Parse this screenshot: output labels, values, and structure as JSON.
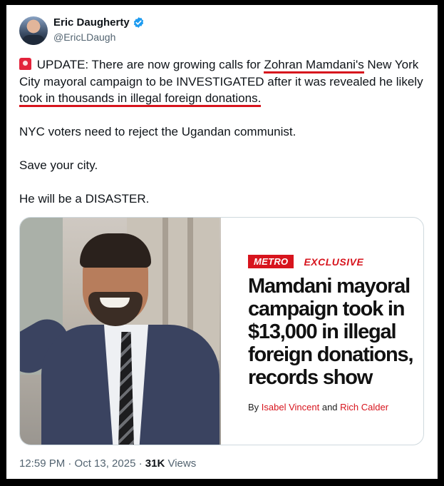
{
  "author": {
    "name": "Eric Daugherty",
    "handle": "@EricLDaugh",
    "verified_color": "#1d9bf0"
  },
  "tweet": {
    "siren_icon": "rotating-light-emoji",
    "p1_a": " UPDATE: There are now growing calls for ",
    "p1_link": "Zohran Mamdani's",
    "p1_b": " New York City mayoral campaign to be INVESTIGATED after it was revealed he likely ",
    "p1_hl": "took in thousands in illegal foreign donations.",
    "p2": "NYC voters need to reject the Ugandan communist.",
    "p3": "Save your city.",
    "p4": "He will be a DISASTER."
  },
  "media": {
    "section": "METRO",
    "label": "EXCLUSIVE",
    "headline": "Mamdani mayoral campaign took in $13,000 in illegal foreign donations, records show",
    "by": "By ",
    "author1": "Isabel Vincent",
    "and": " and ",
    "author2": "Rich Calder",
    "accent": "#d7141d"
  },
  "meta": {
    "time": "12:59 PM · Oct 13, 2025 · ",
    "views_count": "31K",
    "views_label": " Views"
  }
}
